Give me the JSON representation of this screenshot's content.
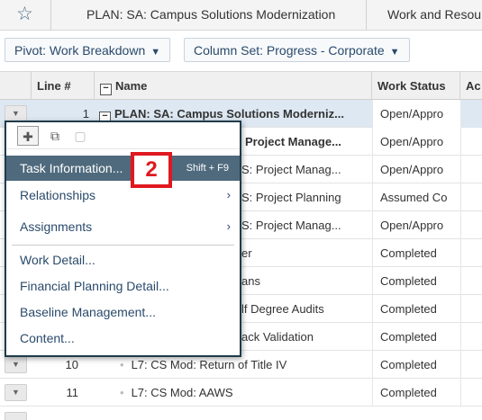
{
  "header": {
    "star_icon": "star-icon",
    "tabs": [
      "PLAN:  SA: Campus Solutions Modernization",
      "Work and Resou"
    ]
  },
  "toolbar": {
    "pivot_label": "Pivot:  Work Breakdown",
    "column_set_label": "Column Set: Progress - Corporate"
  },
  "grid": {
    "columns": {
      "line": "Line #",
      "name": "Name",
      "status": "Work Status",
      "act": "Ac"
    },
    "rows": [
      {
        "line": "1",
        "name": "PLAN: SA: Campus Solutions Moderniz...",
        "status": "Open/Appro"
      },
      {
        "line": "",
        "name": "Project Manage...",
        "status": "Open/Appro"
      },
      {
        "line": "",
        "name": "S: Project Manag...",
        "status": "Open/Appro"
      },
      {
        "line": "",
        "name": "S: Project Planning",
        "status": "Assumed Co"
      },
      {
        "line": "",
        "name": "S: Project Manag...",
        "status": "Open/Appro"
      },
      {
        "line": "",
        "name": "er",
        "status": "Completed"
      },
      {
        "line": "",
        "name": "ans",
        "status": "Completed"
      },
      {
        "line": "",
        "name": "lf Degree Audits",
        "status": "Completed"
      },
      {
        "line": "",
        "name": "ack Validation",
        "status": "Completed"
      },
      {
        "line": "10",
        "name": "L7: CS Mod: Return of Title IV",
        "status": "Completed"
      },
      {
        "line": "11",
        "name": "L7: CS Mod: AAWS",
        "status": "Completed"
      }
    ]
  },
  "menu": {
    "items": {
      "task_info": "Task Information...",
      "task_info_shortcut": "Shift + F9",
      "relationships": "Relationships",
      "assignments": "Assignments",
      "work_detail": "Work Detail...",
      "financial": "Financial Planning Detail...",
      "baseline": "Baseline Management...",
      "content": "Content..."
    }
  },
  "callout": {
    "number": "2"
  },
  "colors": {
    "highlight": "#4f6a7d",
    "callout": "#e0181f",
    "link": "#2a4a6b"
  }
}
